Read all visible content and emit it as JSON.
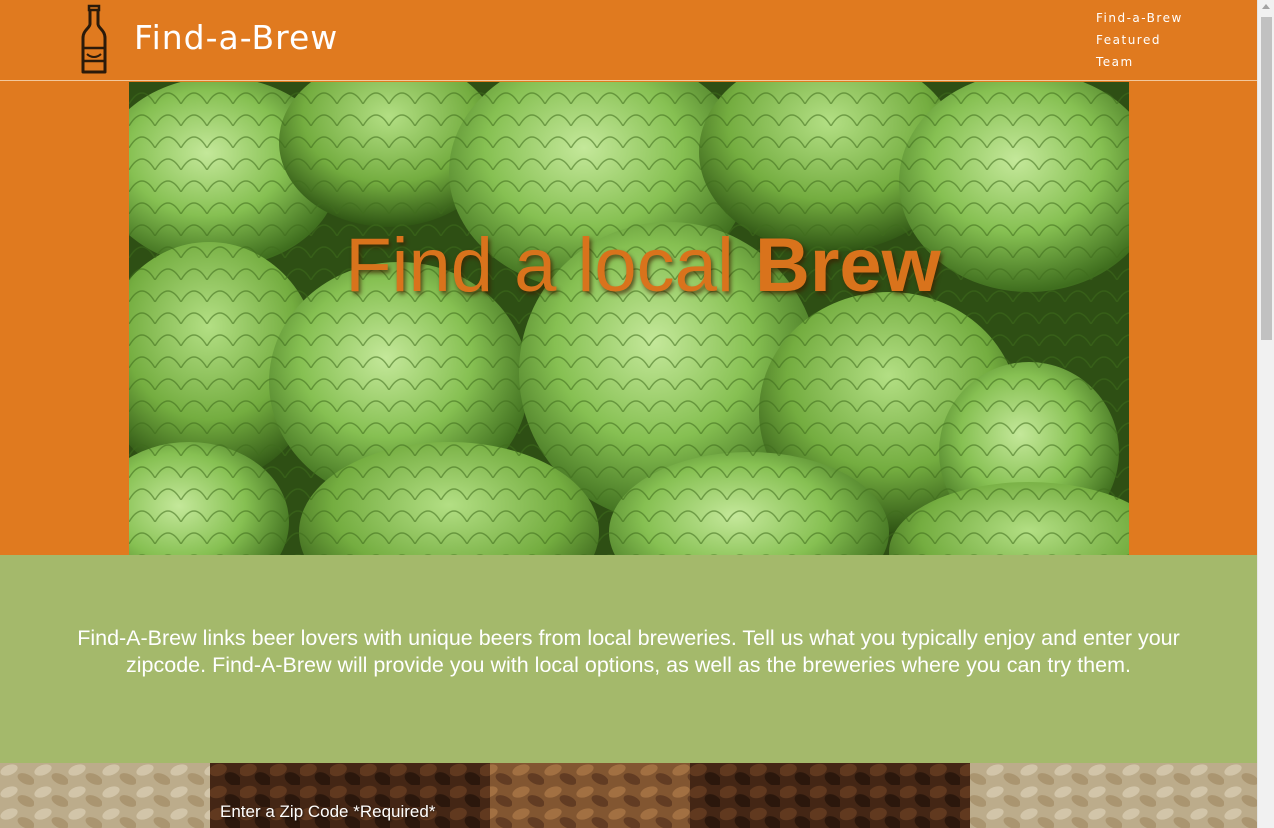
{
  "header": {
    "site_title": "Find-a-Brew",
    "logo_icon": "beer-bottle-icon",
    "nav": [
      {
        "label": "Find-a-Brew"
      },
      {
        "label": "Featured"
      },
      {
        "label": "Team"
      }
    ]
  },
  "hero": {
    "title_light": "Find a local ",
    "title_bold": "Brew",
    "background": "green hops"
  },
  "about": {
    "text": "Find-A-Brew links beer lovers with unique beers from local breweries. Tell us what you typically enjoy and enter your zipcode. Find-A-Brew will provide you with local options, as well as the breweries where you can try them."
  },
  "search": {
    "zip_label": "Enter a Zip Code *Required*",
    "background": "malted grains"
  },
  "colors": {
    "brand_orange": "#e07a1f",
    "about_green": "#a4b96b",
    "hero_text": "#d9731c"
  }
}
